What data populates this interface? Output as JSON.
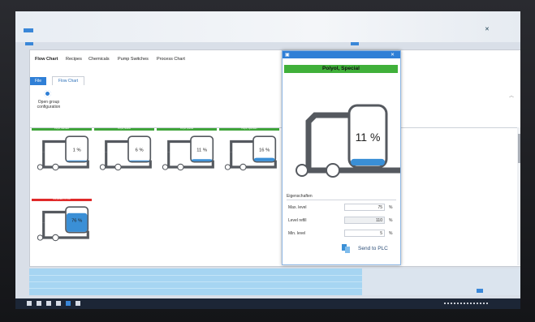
{
  "menu": [
    "Flow Chart",
    "Recipes",
    "Chemicals",
    "Pump Switches",
    "Process Chart"
  ],
  "ribbon": {
    "file_tab": "File",
    "flow_tab": "Flow Chart",
    "open_group_label": "Open group configuration"
  },
  "tanks": [
    {
      "header": "Polyol, standard",
      "percent": "1 %",
      "level": 0.01,
      "status": "green"
    },
    {
      "header": "Polyol, flexible",
      "percent": "6 %",
      "level": 0.06,
      "status": "green"
    },
    {
      "header": "Polyol, special",
      "percent": "11 %",
      "level": 0.11,
      "status": "green"
    },
    {
      "header": "Polyol, rigid-foam",
      "percent": "16 %",
      "level": 0.16,
      "status": "green"
    },
    {
      "header": "Isocyanate, PU 100",
      "percent": "76 %",
      "level": 0.76,
      "status": "red"
    }
  ],
  "popup": {
    "title": "Polyol, Special",
    "percent": "11 %",
    "level": 0.11,
    "properties_heading": "Eigenschaften",
    "rows": [
      {
        "label": "Max. level",
        "value": "75",
        "unit": "%"
      },
      {
        "label": "Level refill",
        "value": "110",
        "unit": "%"
      },
      {
        "label": "Min. level",
        "value": "5",
        "unit": "%"
      }
    ],
    "send_label": "Send to PLC"
  },
  "colors": {
    "accent": "#2f7fd6",
    "ok": "#40b03a",
    "alarm": "#e02a2a",
    "liquid": "#3a8fd6"
  }
}
